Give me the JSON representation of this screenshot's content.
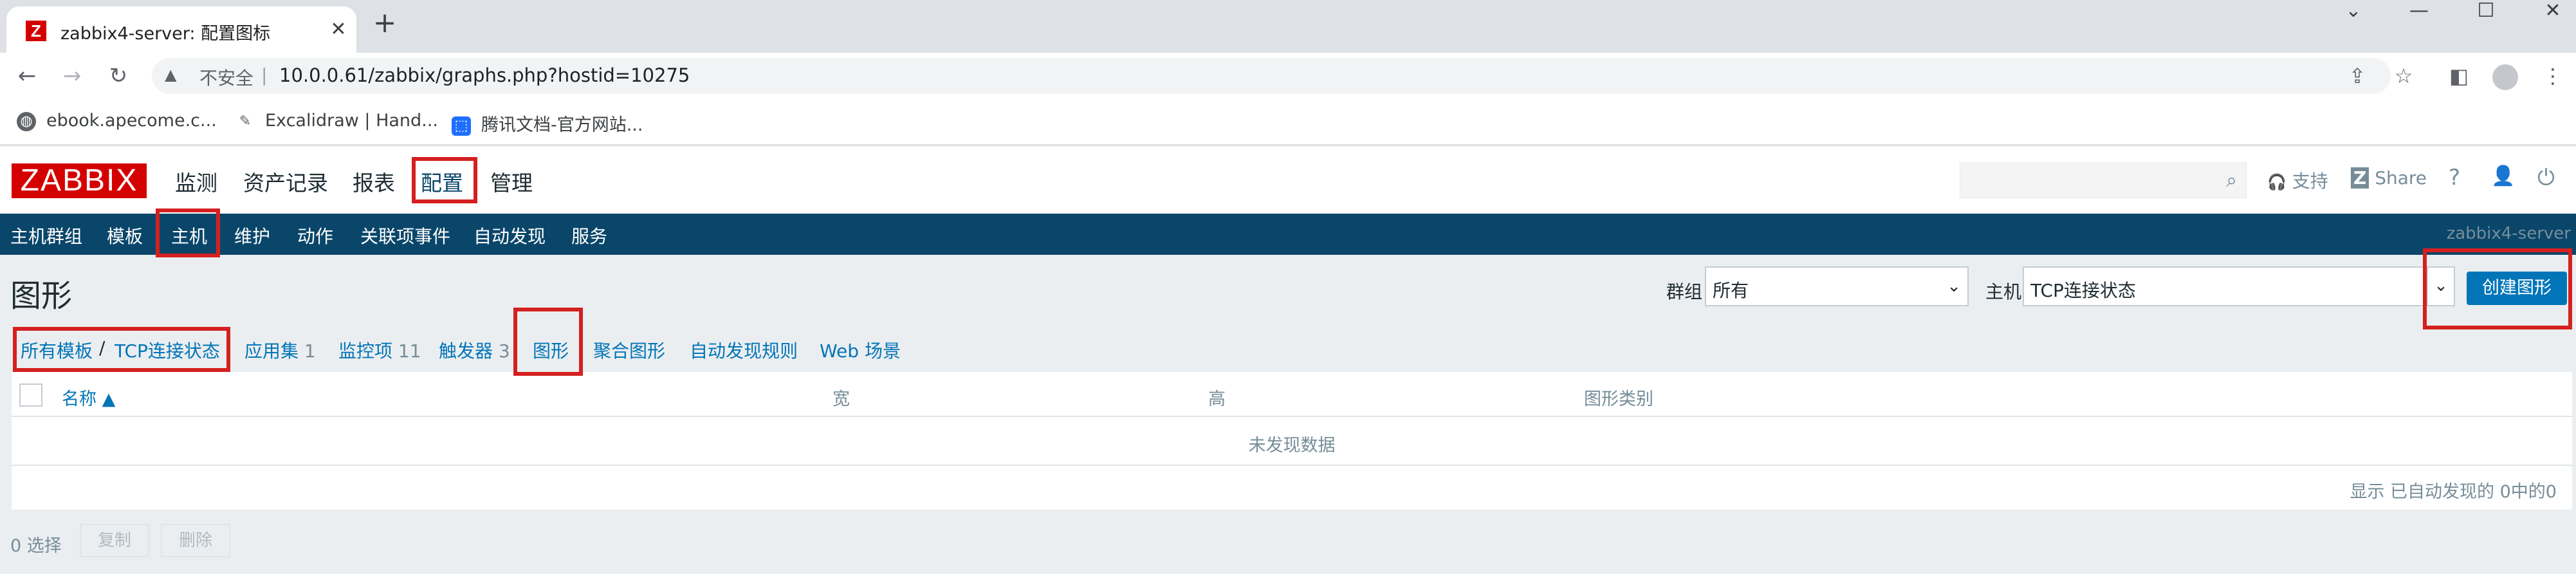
{
  "browser": {
    "tab_title": "zabbix4-server: 配置图标",
    "tab_favicon": "Z",
    "tab_close": "✕",
    "new_tab": "+",
    "window_controls": {
      "minimize": "—",
      "maximize": "☐",
      "close": "✕",
      "chevron": "⌄"
    },
    "nav": {
      "back": "←",
      "forward": "→",
      "reload": "↻"
    },
    "address": {
      "warning_icon": "▲",
      "insecure": "不安全",
      "separator": "|",
      "url": "10.0.0.61/zabbix/graphs.php?hostid=10275"
    },
    "toolbar_icons": {
      "share": "⇪",
      "star": "☆",
      "sidebar": "◧",
      "menu": "⋮"
    },
    "bookmarks": [
      {
        "label": "ebook.apecome.c...",
        "icon": "globe-icon"
      },
      {
        "label": "Excalidraw | Hand...",
        "icon": "pen-icon"
      },
      {
        "label": "腾讯文档-官方网站...",
        "icon": "tencent-docs-icon"
      }
    ]
  },
  "zabbix": {
    "logo": "ZABBIX",
    "main_menu": [
      "监测",
      "资产记录",
      "报表",
      "配置",
      "管理"
    ],
    "main_menu_selected": "配置",
    "header_links": {
      "support": "支持",
      "share": "Share",
      "help": "?",
      "user": "👤",
      "logout": "⏻",
      "search_icon": "⌕",
      "support_icon": "🎧",
      "share_icon": "Z"
    },
    "sub_menu": [
      "主机群组",
      "模板",
      "主机",
      "维护",
      "动作",
      "关联项事件",
      "自动发现",
      "服务"
    ],
    "sub_menu_selected": "主机",
    "server_name": "zabbix4-server"
  },
  "page": {
    "title": "图形",
    "filter": {
      "group_label": "群组",
      "group_value": "所有",
      "host_label": "主机",
      "host_value": "TCP连接状态",
      "chevron": "⌄",
      "create_button": "创建图形"
    },
    "breadcrumbs": {
      "all_templates": "所有模板",
      "separator": "/",
      "template": "TCP连接状态",
      "applications": "应用集",
      "applications_count": "1",
      "items": "监控项",
      "items_count": "11",
      "triggers": "触发器",
      "triggers_count": "3",
      "graphs": "图形",
      "screens": "聚合图形",
      "discovery_rules": "自动发现规则",
      "web": "Web 场景"
    },
    "table": {
      "columns": [
        "名称 ▲",
        "宽",
        "高",
        "图形类别"
      ],
      "no_data": "未发现数据",
      "display_info": "显示 已自动发现的 0中的0"
    },
    "footer": {
      "selected": "0 选择",
      "copy": "复制",
      "delete": "删除"
    }
  },
  "colors": {
    "zabbix_red": "#d40000",
    "nav_blue": "#0a466a",
    "link_blue": "#0275b8",
    "annotation_red": "#d42020"
  }
}
